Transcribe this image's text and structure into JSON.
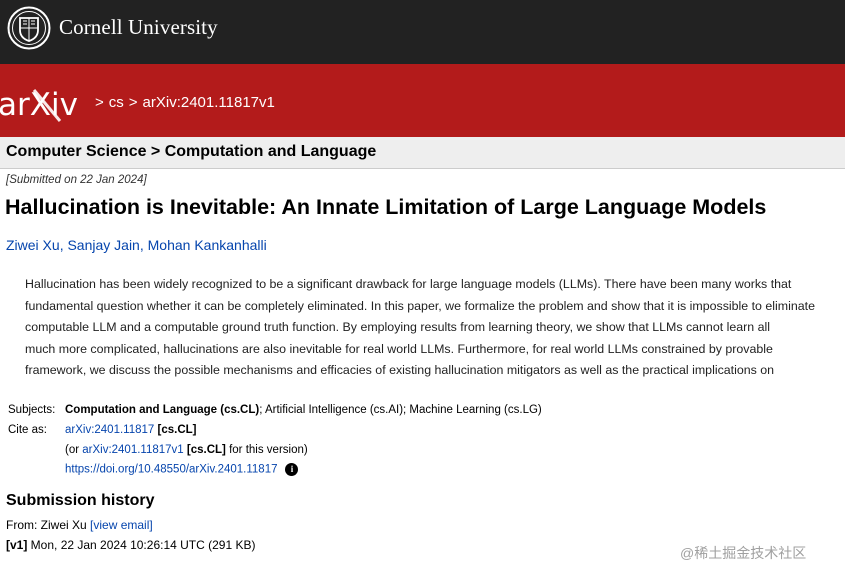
{
  "header": {
    "institution": "Cornell University"
  },
  "breadcrumb": {
    "logo_text": "arXiv",
    "separator": ">",
    "items": [
      "cs",
      "arXiv:2401.11817v1"
    ]
  },
  "subheader": {
    "text": "Computer Science > Computation and Language"
  },
  "paper": {
    "submitted": "[Submitted on 22 Jan 2024]",
    "title": "Hallucination is Inevitable: An Innate Limitation of Large Language Models",
    "authors": [
      "Ziwei Xu",
      "Sanjay Jain",
      "Mohan Kankanhalli"
    ],
    "author_separator": ",",
    "abstract_lines": [
      "Hallucination has been widely recognized to be a significant drawback for large language models (LLMs). There have been many works that",
      "fundamental question whether it can be completely eliminated. In this paper, we formalize the problem and show that it is impossible to eliminate",
      "computable LLM and a computable ground truth function. By employing results from learning theory, we show that LLMs cannot learn all",
      "much more complicated, hallucinations are also inevitable for real world LLMs. Furthermore, for real world LLMs constrained by provable",
      "framework, we discuss the possible mechanisms and efficacies of existing hallucination mitigators as well as the practical implications on"
    ]
  },
  "metadata": {
    "subjects_label": "Subjects:",
    "subjects_primary": "Computation and Language (cs.CL)",
    "subjects_rest": "; Artificial Intelligence (cs.AI); Machine Learning (cs.LG)",
    "cite_label": "Cite as:",
    "cite_id": "arXiv:2401.11817",
    "cite_tag": "[cs.CL]",
    "or_prefix": "(or ",
    "version_id": "arXiv:2401.11817v1",
    "version_tag": "[cs.CL]",
    "version_suffix": " for this version)",
    "doi": "https://doi.org/10.48550/arXiv.2401.11817",
    "info_icon": "i"
  },
  "history": {
    "title": "Submission history",
    "from_prefix": "From: Ziwei Xu ",
    "view_email": "[view email]",
    "v1_tag": "[v1]",
    "v1_text": " Mon, 22 Jan 2024 10:26:14 UTC (291 KB)"
  },
  "watermark": "@稀土掘金技术社区",
  "colors": {
    "top_bar": "#222222",
    "arxiv_red": "#b31b1b",
    "link": "#0645ad",
    "subheader_bg": "#eeeeee"
  }
}
